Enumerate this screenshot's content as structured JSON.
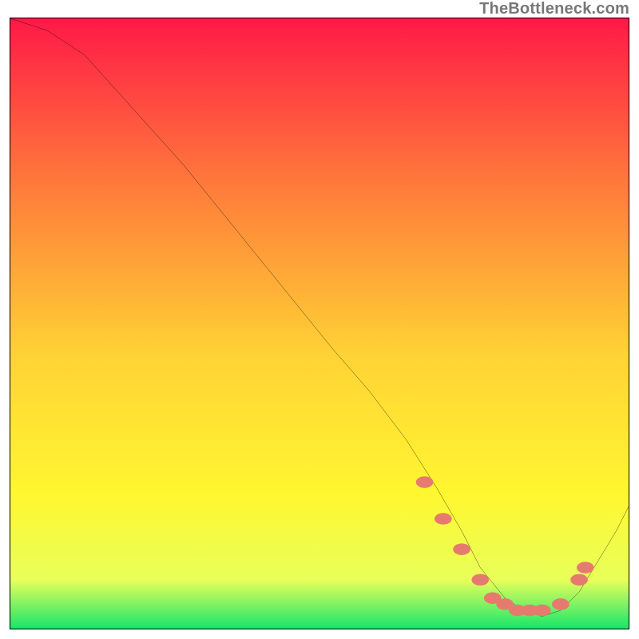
{
  "watermark": "TheBottleneck.com",
  "chart_data": {
    "type": "line",
    "title": "",
    "xlabel": "",
    "ylabel": "",
    "xlim": [
      0,
      100
    ],
    "ylim": [
      0,
      100
    ],
    "grid": false,
    "legend": false,
    "gradient_colors": {
      "top": "#ff1947",
      "mid_a": "#ff7d3a",
      "mid_b": "#ffd235",
      "mid_c": "#fff730",
      "near_b": "#e8ff5a",
      "bottom": "#17e66b"
    },
    "curve_color": "#000000",
    "marker_color": "#e77a6f",
    "series_curve": {
      "name": "curve",
      "x": [
        0,
        6,
        12,
        20,
        28,
        36,
        44,
        52,
        58,
        64,
        69,
        73,
        76,
        80,
        83,
        86,
        89,
        92,
        95,
        98,
        100
      ],
      "y": [
        100,
        98,
        94,
        85,
        76,
        66,
        56,
        46,
        39,
        31,
        23,
        16,
        10,
        5,
        3,
        2,
        3,
        6,
        11,
        16,
        20
      ]
    },
    "series_markers": {
      "name": "dots",
      "x": [
        67,
        70,
        73,
        76,
        78,
        80,
        82,
        84,
        86,
        89,
        92,
        93
      ],
      "y": [
        24,
        18,
        13,
        8,
        5,
        4,
        3,
        3,
        3,
        4,
        8,
        10
      ]
    }
  }
}
